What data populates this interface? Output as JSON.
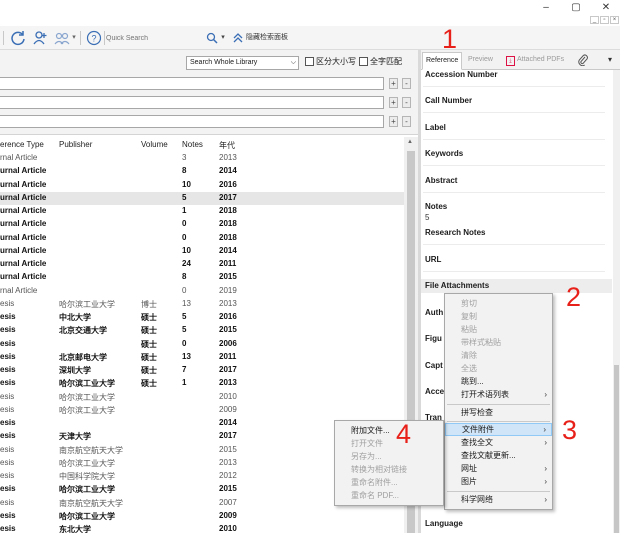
{
  "window": {
    "minimize": "–",
    "maximize": "▢",
    "close": "✕"
  },
  "toolbar": {
    "search_placeholder": "Quick Search",
    "hide_search_panel": "隐藏检索面板"
  },
  "search_pane": {
    "scope": "Search Whole Library",
    "match_case": "区分大小写",
    "match_words": "全字匹配",
    "plus": "+",
    "minus": "-"
  },
  "ref_table": {
    "headers": [
      "erence Type",
      "Publisher",
      "Volume",
      "Notes",
      "年代"
    ],
    "rows": [
      {
        "type": "rnal Article",
        "publisher": "",
        "volume": "",
        "notes": "3",
        "year": "2013",
        "bold": false,
        "selected": false
      },
      {
        "type": "urnal Article",
        "publisher": "",
        "volume": "",
        "notes": "8",
        "year": "2014",
        "bold": true,
        "selected": false
      },
      {
        "type": "urnal Article",
        "publisher": "",
        "volume": "",
        "notes": "10",
        "year": "2016",
        "bold": true,
        "selected": false
      },
      {
        "type": "urnal Article",
        "publisher": "",
        "volume": "",
        "notes": "5",
        "year": "2017",
        "bold": true,
        "selected": true
      },
      {
        "type": "urnal Article",
        "publisher": "",
        "volume": "",
        "notes": "1",
        "year": "2018",
        "bold": true,
        "selected": false
      },
      {
        "type": "urnal Article",
        "publisher": "",
        "volume": "",
        "notes": "0",
        "year": "2018",
        "bold": true,
        "selected": false
      },
      {
        "type": "urnal Article",
        "publisher": "",
        "volume": "",
        "notes": "0",
        "year": "2018",
        "bold": true,
        "selected": false
      },
      {
        "type": "urnal Article",
        "publisher": "",
        "volume": "",
        "notes": "10",
        "year": "2014",
        "bold": true,
        "selected": false
      },
      {
        "type": "urnal Article",
        "publisher": "",
        "volume": "",
        "notes": "24",
        "year": "2011",
        "bold": true,
        "selected": false
      },
      {
        "type": "urnal Article",
        "publisher": "",
        "volume": "",
        "notes": "8",
        "year": "2015",
        "bold": true,
        "selected": false
      },
      {
        "type": "rnal Article",
        "publisher": "",
        "volume": "",
        "notes": "0",
        "year": "2019",
        "bold": false,
        "selected": false
      },
      {
        "type": "esis",
        "publisher": "哈尔滨工业大学",
        "volume": "博士",
        "notes": "13",
        "year": "2013",
        "bold": false,
        "selected": false
      },
      {
        "type": "esis",
        "publisher": "中北大学",
        "volume": "硕士",
        "notes": "5",
        "year": "2016",
        "bold": true,
        "selected": false
      },
      {
        "type": "esis",
        "publisher": "北京交通大学",
        "volume": "硕士",
        "notes": "5",
        "year": "2015",
        "bold": true,
        "selected": false
      },
      {
        "type": "esis",
        "publisher": "",
        "volume": "硕士",
        "notes": "0",
        "year": "2006",
        "bold": true,
        "selected": false
      },
      {
        "type": "esis",
        "publisher": "北京邮电大学",
        "volume": "硕士",
        "notes": "13",
        "year": "2011",
        "bold": true,
        "selected": false
      },
      {
        "type": "esis",
        "publisher": "深圳大学",
        "volume": "硕士",
        "notes": "7",
        "year": "2017",
        "bold": true,
        "selected": false
      },
      {
        "type": "esis",
        "publisher": "哈尔滨工业大学",
        "volume": "硕士",
        "notes": "1",
        "year": "2013",
        "bold": true,
        "selected": false
      },
      {
        "type": "esis",
        "publisher": "哈尔滨工业大学",
        "volume": "",
        "notes": "",
        "year": "2010",
        "bold": false,
        "selected": false
      },
      {
        "type": "esis",
        "publisher": "哈尔滨工业大学",
        "volume": "",
        "notes": "",
        "year": "2009",
        "bold": false,
        "selected": false
      },
      {
        "type": "esis",
        "publisher": "",
        "volume": "",
        "notes": "",
        "year": "2014",
        "bold": true,
        "selected": false
      },
      {
        "type": "esis",
        "publisher": "天津大学",
        "volume": "",
        "notes": "",
        "year": "2017",
        "bold": true,
        "selected": false
      },
      {
        "type": "esis",
        "publisher": "南京航空航天大学",
        "volume": "",
        "notes": "",
        "year": "2015",
        "bold": false,
        "selected": false
      },
      {
        "type": "esis",
        "publisher": "哈尔滨工业大学",
        "volume": "",
        "notes": "",
        "year": "2013",
        "bold": false,
        "selected": false
      },
      {
        "type": "esis",
        "publisher": "中国科学院大学",
        "volume": "",
        "notes": "",
        "year": "2012",
        "bold": false,
        "selected": false
      },
      {
        "type": "esis",
        "publisher": "哈尔滨工业大学",
        "volume": "",
        "notes": "",
        "year": "2015",
        "bold": true,
        "selected": false
      },
      {
        "type": "esis",
        "publisher": "南京航空航天大学",
        "volume": "",
        "notes": "",
        "year": "2007",
        "bold": false,
        "selected": false
      },
      {
        "type": "esis",
        "publisher": "哈尔滨工业大学",
        "volume": "",
        "notes": "",
        "year": "2009",
        "bold": true,
        "selected": false
      },
      {
        "type": "esis",
        "publisher": "东北大学",
        "volume": "",
        "notes": "",
        "year": "2010",
        "bold": true,
        "selected": false
      }
    ]
  },
  "right_panel": {
    "tabs": [
      "Reference",
      "Preview",
      "Attached PDFs"
    ],
    "fields": {
      "accession_number": "Accession Number",
      "call_number": "Call Number",
      "label": "Label",
      "keywords": "Keywords",
      "abstract": "Abstract",
      "notes": "Notes",
      "notes_value": "5",
      "research_notes": "Research Notes",
      "url": "URL",
      "file_attachments": "File Attachments",
      "author_partial": "Auth",
      "figure_partial": "Figu",
      "caption_partial": "Capt",
      "access_partial": "Acce",
      "trans_partial": "Tran",
      "language": "Language"
    }
  },
  "context_menu": {
    "items": [
      {
        "label": "剪切",
        "disabled": true,
        "submenu": false
      },
      {
        "label": "复制",
        "disabled": true,
        "submenu": false
      },
      {
        "label": "粘贴",
        "disabled": true,
        "submenu": false
      },
      {
        "label": "带样式粘贴",
        "disabled": true,
        "submenu": false
      },
      {
        "label": "清除",
        "disabled": true,
        "submenu": false
      },
      {
        "label": "全选",
        "disabled": true,
        "submenu": false
      },
      {
        "label": "跳到...",
        "disabled": false,
        "submenu": false
      },
      {
        "label": "打开术语列表",
        "disabled": false,
        "submenu": true
      },
      {
        "label": "拼写检查",
        "disabled": false,
        "submenu": false
      },
      {
        "label": "文件附件",
        "disabled": false,
        "submenu": true,
        "highlighted": true
      },
      {
        "label": "查找全文",
        "disabled": false,
        "submenu": true
      },
      {
        "label": "查找文献更新...",
        "disabled": false,
        "submenu": false
      },
      {
        "label": "网址",
        "disabled": false,
        "submenu": true
      },
      {
        "label": "图片",
        "disabled": false,
        "submenu": true
      },
      {
        "label": "科学网络",
        "disabled": false,
        "submenu": true
      }
    ]
  },
  "submenu": {
    "items": [
      {
        "label": "附加文件...",
        "disabled": false
      },
      {
        "label": "打开文件",
        "disabled": true
      },
      {
        "label": "另存为...",
        "disabled": true
      },
      {
        "label": "转换为相对链接",
        "disabled": true
      },
      {
        "label": "重命名附件...",
        "disabled": true
      },
      {
        "label": "重命名 PDF...",
        "disabled": true
      }
    ]
  },
  "annotations": [
    "1",
    "2",
    "3",
    "4"
  ],
  "colors": {
    "annotation": "#e8201a",
    "highlight": "#d0e5f7",
    "icon_blue": "#3a6eb5"
  }
}
